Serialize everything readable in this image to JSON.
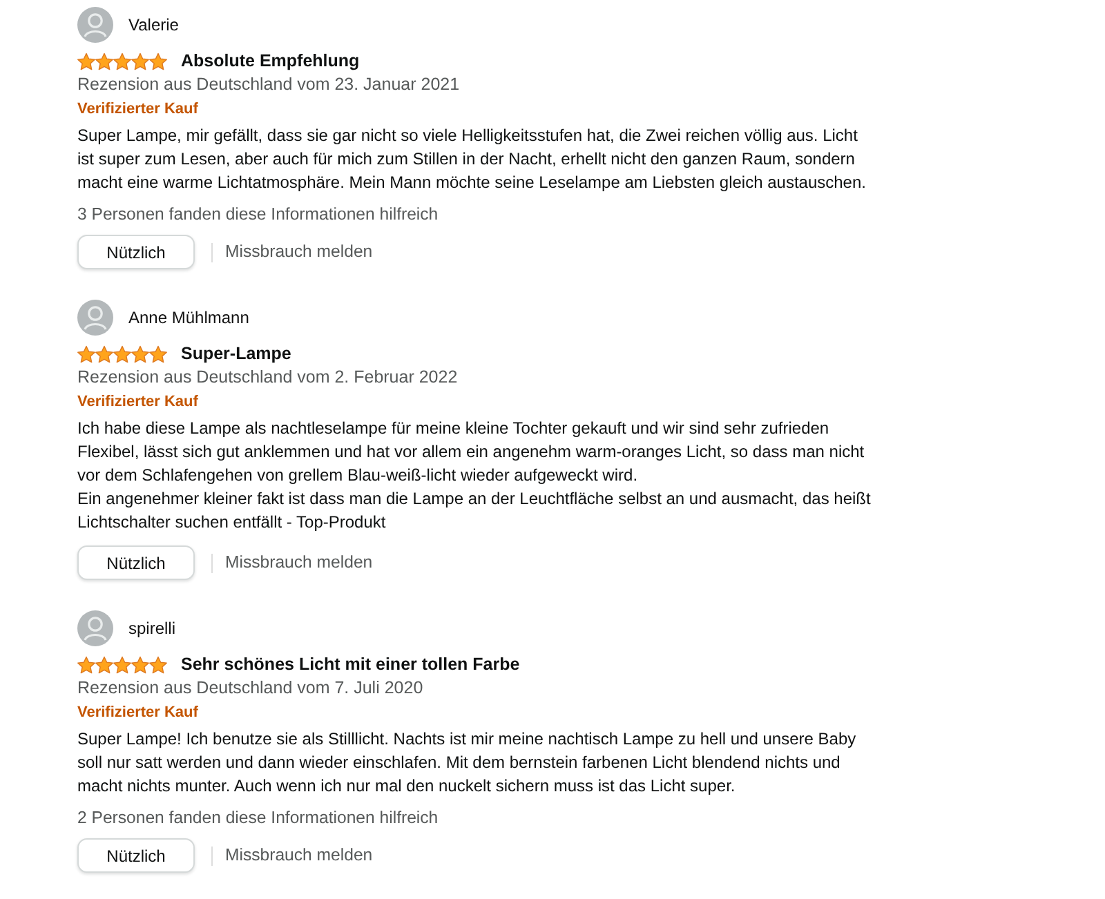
{
  "reviews": [
    {
      "author": "Valerie",
      "stars": 5,
      "title": "Absolute Empfehlung",
      "date": "Rezension aus Deutschland vom 23. Januar 2021",
      "badge": "Verifizierter Kauf",
      "body": "Super Lampe, mir gefällt, dass sie gar nicht so viele Helligkeitsstufen hat, die Zwei reichen völlig aus. Licht ist super zum Lesen, aber auch für mich zum Stillen in der Nacht, erhellt nicht den ganzen Raum, sondern macht eine warme Lichtatmosphäre. Mein Mann möchte seine Leselampe am Liebsten gleich austauschen.",
      "helpful": "3 Personen fanden diese Informationen hilfreich",
      "helpful_button": "Nützlich",
      "report_link": "Missbrauch melden"
    },
    {
      "author": "Anne Mühlmann",
      "stars": 5,
      "title": "Super-Lampe",
      "date": "Rezension aus Deutschland vom 2. Februar 2022",
      "badge": "Verifizierter Kauf",
      "body": "Ich habe diese Lampe als nachtleselampe für meine kleine Tochter gekauft und wir sind sehr zufrieden\nFlexibel, lässt sich gut anklemmen und hat vor allem ein angenehm warm-oranges Licht, so dass man nicht vor dem Schlafengehen von grellem Blau-weiß-licht wieder aufgeweckt wird.\nEin angenehmer kleiner fakt ist dass man die Lampe an der Leuchtfläche selbst an und ausmacht, das heißt Lichtschalter suchen entfällt - Top-Produkt",
      "helpful_button": "Nützlich",
      "report_link": "Missbrauch melden"
    },
    {
      "author": "spirelli",
      "stars": 5,
      "title": "Sehr schönes Licht mit einer tollen Farbe",
      "date": "Rezension aus Deutschland vom 7. Juli 2020",
      "badge": "Verifizierter Kauf",
      "body": "Super Lampe! Ich benutze sie als Stilllicht. Nachts ist mir meine nachtisch Lampe zu hell und unsere Baby soll nur satt werden und dann wieder einschlafen. Mit dem bernstein farbenen Licht blendend nichts und macht nichts munter. Auch wenn ich nur mal den nuckelt sichern muss ist das Licht super.",
      "helpful": "2 Personen fanden diese Informationen hilfreich",
      "helpful_button": "Nützlich",
      "report_link": "Missbrauch melden"
    }
  ]
}
